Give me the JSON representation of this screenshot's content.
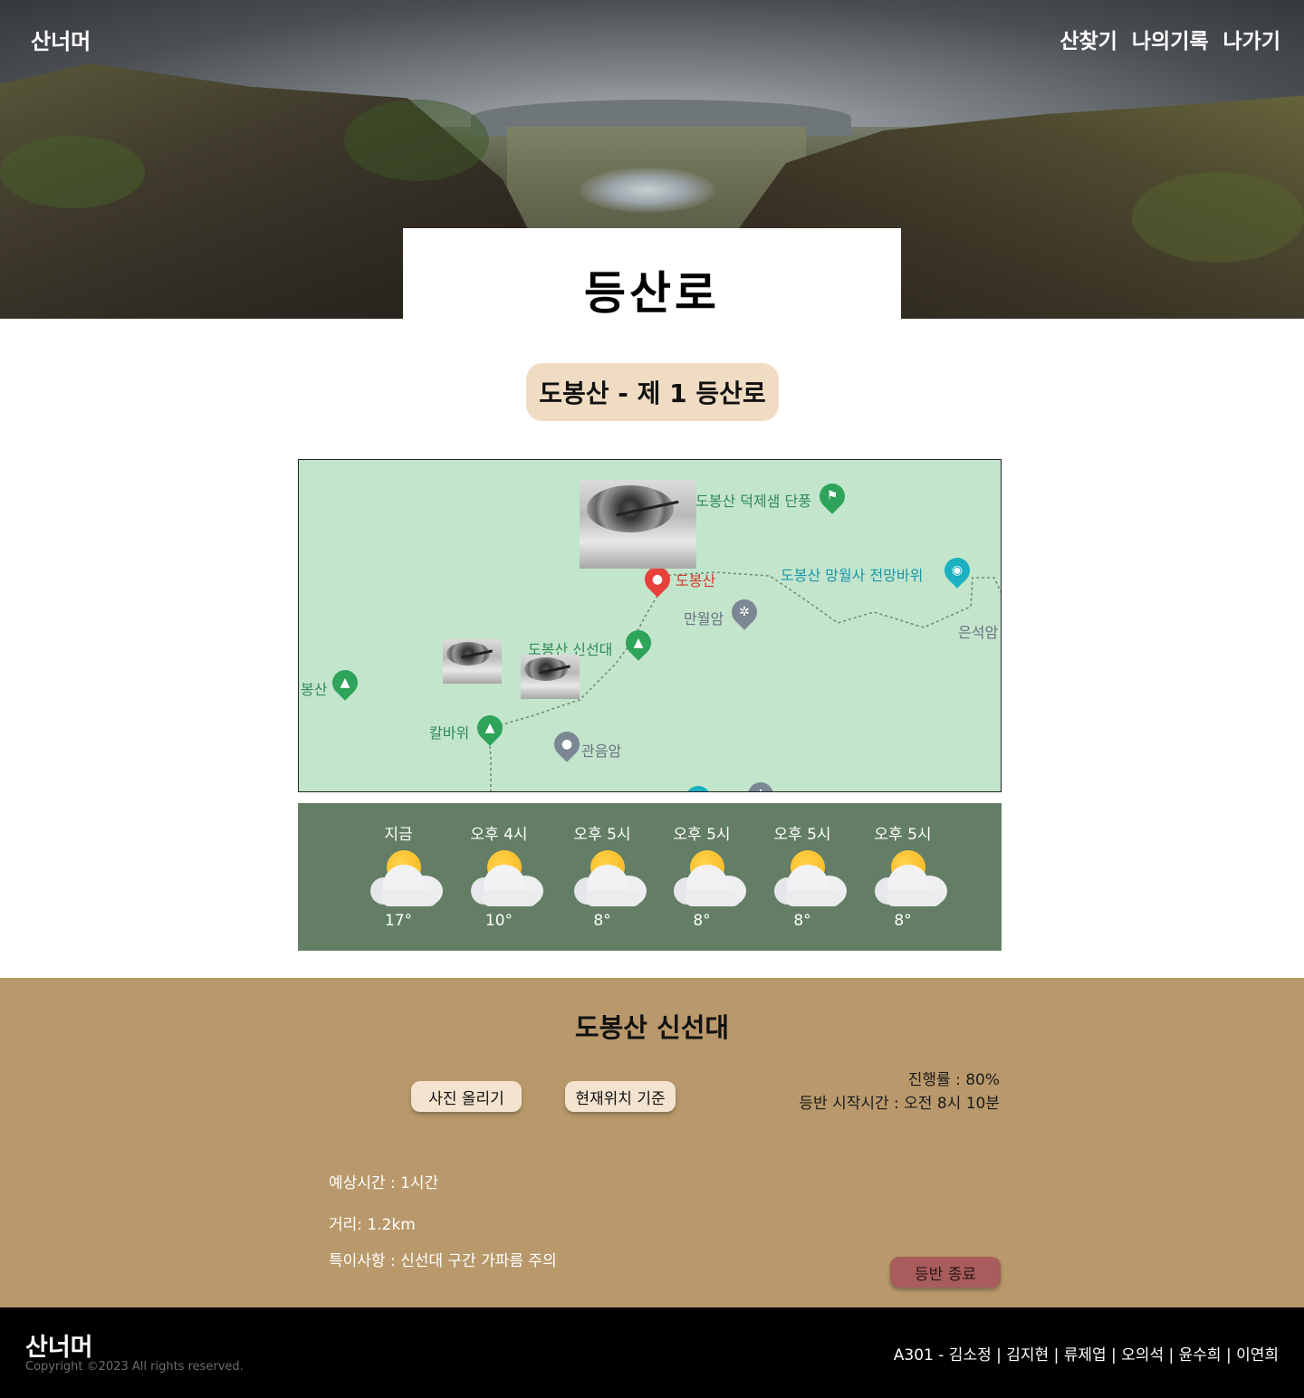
{
  "brand": {
    "logo": "산너머"
  },
  "nav": {
    "items": [
      "산찾기",
      "나의기록",
      "나가기"
    ]
  },
  "page_title": "등산로",
  "trail_name": "도봉산 - 제 1 등산로",
  "map": {
    "labels": {
      "deokjesaem": "도봉산 덕제샘 단풍",
      "peak": "도봉산",
      "mangwolsa": "도봉산 망월사 전망바위",
      "manwolam": "만월암",
      "eunseogam": "은석암",
      "sinseondae": "도봉산 신선대",
      "bongsan": "봉산",
      "kalbawi": "칼바위",
      "gwaneumam": "관음암"
    }
  },
  "weather": [
    {
      "time": "지금",
      "temp": "17°",
      "icon": "partly-cloudy-icon"
    },
    {
      "time": "오후 4시",
      "temp": "10°",
      "icon": "partly-cloudy-icon"
    },
    {
      "time": "오후 5시",
      "temp": "8°",
      "icon": "partly-cloudy-icon"
    },
    {
      "time": "오후 5시",
      "temp": "8°",
      "icon": "partly-cloudy-icon"
    },
    {
      "time": "오후 5시",
      "temp": "8°",
      "icon": "partly-cloudy-icon"
    },
    {
      "time": "오후 5시",
      "temp": "8°",
      "icon": "partly-cloudy-icon"
    }
  ],
  "details": {
    "title": "도봉산 신선대",
    "upload_button": "사진 올리기",
    "location_button": "현재위치 기준",
    "progress": "진행률 : 80%",
    "start_time": "등반 시작시간 : 오전 8시 10분",
    "expected_time": "예상시간 : 1시간",
    "distance": "거리: 1.2km",
    "notes": "특이사항 : 신선대 구간 가파름 주의",
    "end_button": "등반 종료"
  },
  "footer": {
    "logo": "산너머",
    "copyright": "Copyright ©2023 All rights reserved.",
    "team": "A301 - 김소정 | 김지현 | 류제엽 | 오의석 | 윤수희 | 이연희"
  },
  "colors": {
    "trail_pill": "#f0dcc2",
    "weather_bg": "#647e65",
    "details_bg": "#b9996b",
    "end_button": "#a85c5c",
    "map_bg": "#c3e5cc"
  }
}
